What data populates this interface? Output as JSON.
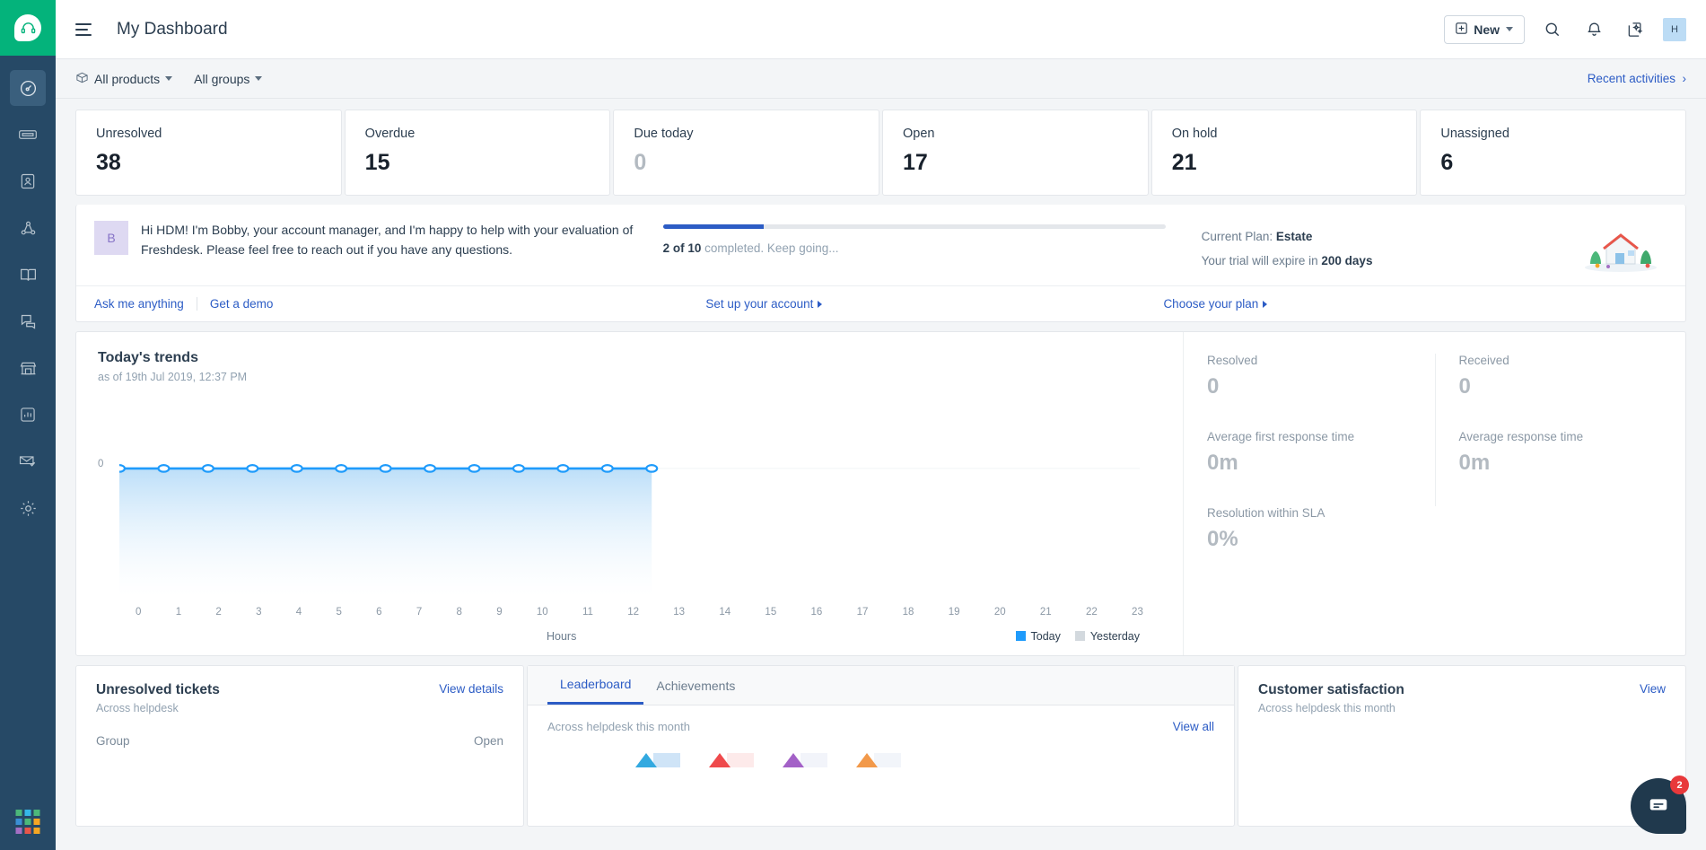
{
  "sidebar": {
    "logo_icon": "freshdesk-headset-logo",
    "items": [
      {
        "name": "dashboard",
        "icon": "gauge-icon",
        "active": true
      },
      {
        "name": "tickets",
        "icon": "ticket-icon",
        "active": false
      },
      {
        "name": "contacts",
        "icon": "contact-card-icon",
        "active": false
      },
      {
        "name": "social",
        "icon": "social-network-icon",
        "active": false
      },
      {
        "name": "solutions",
        "icon": "book-icon",
        "active": false
      },
      {
        "name": "forums",
        "icon": "chat-bubbles-icon",
        "active": false
      },
      {
        "name": "marketplace",
        "icon": "shop-icon",
        "active": false
      },
      {
        "name": "analytics",
        "icon": "bar-chart-icon",
        "active": false
      },
      {
        "name": "email",
        "icon": "envelope-check-icon",
        "active": false
      },
      {
        "name": "admin",
        "icon": "gear-icon",
        "active": false
      }
    ],
    "app_switcher_icon": "grid-apps-icon"
  },
  "header": {
    "menu_icon": "hamburger-icon",
    "title": "My Dashboard",
    "new_label": "New",
    "new_icon": "plus-box-icon",
    "search_icon": "search-icon",
    "notifications_icon": "bell-icon",
    "freddy_icon": "sparkle-ai-icon",
    "avatar_initial": "H"
  },
  "filterbar": {
    "products_label": "All products",
    "products_icon": "products-icon",
    "groups_label": "All groups",
    "recent_label": "Recent activities",
    "recent_chevron": "chevron-right-icon"
  },
  "kpis": [
    {
      "label": "Unresolved",
      "value": "38",
      "zero": false
    },
    {
      "label": "Overdue",
      "value": "15",
      "zero": false
    },
    {
      "label": "Due today",
      "value": "0",
      "zero": true
    },
    {
      "label": "Open",
      "value": "17",
      "zero": false
    },
    {
      "label": "On hold",
      "value": "21",
      "zero": false
    },
    {
      "label": "Unassigned",
      "value": "6",
      "zero": false
    }
  ],
  "banner": {
    "avatar_initial": "B",
    "message": "Hi HDM! I'm Bobby, your account manager, and I'm happy to help with your evaluation of Freshdesk. Please feel free to reach out if you have any questions.",
    "progress_percent": 20,
    "progress_count": "2 of 10",
    "progress_rest": " completed. Keep going...",
    "plan_label": "Current Plan: ",
    "plan_value": "Estate",
    "trial_prefix": "Your trial will expire in ",
    "trial_value": "200 days",
    "art_icon": "house-garden-illustration",
    "links": {
      "ask": "Ask me anything",
      "demo": "Get a demo",
      "setup": "Set up your account",
      "plan": "Choose your plan"
    }
  },
  "trends": {
    "title": "Today's trends",
    "subtitle": "as of 19th Jul 2019, 12:37 PM",
    "metrics": [
      {
        "label": "Resolved",
        "value": "0"
      },
      {
        "label": "Received",
        "value": "0"
      },
      {
        "label": "Average first response time",
        "value": "0m"
      },
      {
        "label": "Average response time",
        "value": "0m"
      },
      {
        "label": "Resolution within SLA",
        "value": "0%"
      }
    ]
  },
  "chart_data": {
    "type": "line",
    "title": "Today's trends",
    "xlabel": "Hours",
    "ylabel": "",
    "x": [
      0,
      1,
      2,
      3,
      4,
      5,
      6,
      7,
      8,
      9,
      10,
      11,
      12,
      13,
      14,
      15,
      16,
      17,
      18,
      19,
      20,
      21,
      22,
      23
    ],
    "tick_labels": [
      "0",
      "1",
      "2",
      "3",
      "4",
      "5",
      "6",
      "7",
      "8",
      "9",
      "10",
      "11",
      "12",
      "13",
      "14",
      "15",
      "16",
      "17",
      "18",
      "19",
      "20",
      "21",
      "22",
      "23"
    ],
    "ytick_labels": [
      "0"
    ],
    "ylim": [
      0,
      1
    ],
    "grid": false,
    "legend_position": "bottom-right",
    "series": [
      {
        "name": "Today",
        "color": "#1f9bfb",
        "values": [
          0,
          0,
          0,
          0,
          0,
          0,
          0,
          0,
          0,
          0,
          0,
          0,
          0,
          null,
          null,
          null,
          null,
          null,
          null,
          null,
          null,
          null,
          null,
          null
        ],
        "points_drawn": 13
      },
      {
        "name": "Yesterday",
        "color": "#d3d9de",
        "values": [
          null,
          null,
          null,
          null,
          null,
          null,
          null,
          null,
          null,
          null,
          null,
          null,
          null,
          null,
          null,
          null,
          null,
          null,
          null,
          null,
          null,
          null,
          null,
          null
        ],
        "points_drawn": 0
      }
    ],
    "legend": [
      "Today",
      "Yesterday"
    ]
  },
  "bottom": {
    "unresolved": {
      "title": "Unresolved tickets",
      "subtitle": "Across helpdesk",
      "link": "View details",
      "columns": [
        "Group",
        "Open"
      ]
    },
    "leaderboard": {
      "tabs": [
        {
          "label": "Leaderboard",
          "active": true
        },
        {
          "label": "Achievements",
          "active": false
        }
      ],
      "scope": "Across helpdesk this month",
      "link": "View all",
      "badge_colors": [
        "#33a9e0",
        "#ef4a4c",
        "#a361c7",
        "#f2994a"
      ]
    },
    "satisfaction": {
      "title": "Customer satisfaction",
      "subtitle": "Across helpdesk this month",
      "link": "View"
    }
  },
  "chat_widget": {
    "icon": "message-icon",
    "unread_count": "2",
    "color": "#20394d",
    "badge_color": "#e8393b"
  }
}
